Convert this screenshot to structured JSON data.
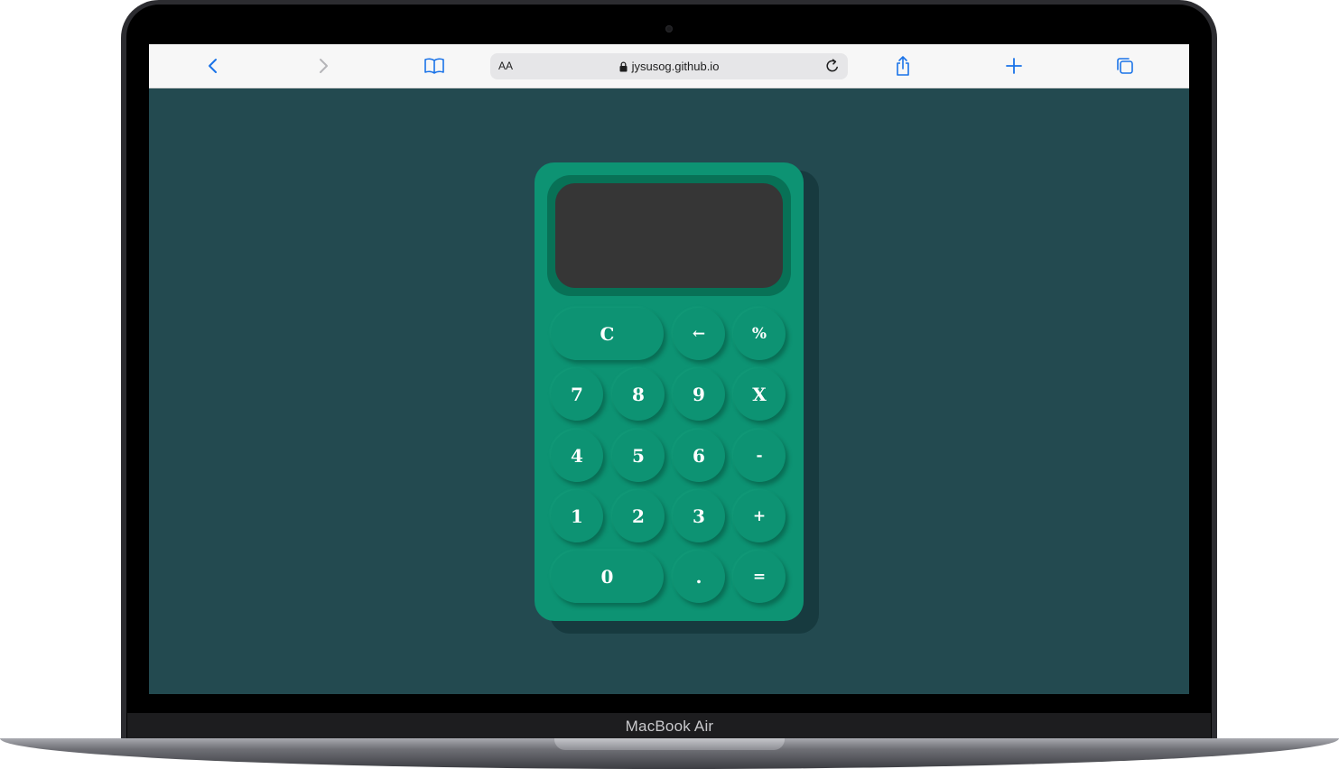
{
  "device": {
    "model_label": "MacBook Air"
  },
  "browser": {
    "aa_label": "AA",
    "url": "jysusog.github.io",
    "buttons": {
      "back": "chevron-left-icon",
      "forward": "chevron-right-icon",
      "bookmarks": "book-icon",
      "lock": "lock-icon",
      "reload": "reload-icon",
      "share": "share-icon",
      "new_tab": "plus-icon",
      "tabs": "tabs-icon"
    },
    "accent_color": "#1a73e8"
  },
  "calculator": {
    "display_value": "",
    "colors": {
      "page_background": "#234a50",
      "body": "#0d9373",
      "display_frame": "#087156",
      "display": "#363636",
      "key_text": "#ffffff"
    },
    "keys": {
      "clear": "C",
      "backspace": "←",
      "percent": "%",
      "seven": "7",
      "eight": "8",
      "nine": "9",
      "multiply": "X",
      "four": "4",
      "five": "5",
      "six": "6",
      "minus": "-",
      "one": "1",
      "two": "2",
      "three": "3",
      "plus": "+",
      "zero": "0",
      "decimal": ".",
      "equals": "="
    }
  }
}
